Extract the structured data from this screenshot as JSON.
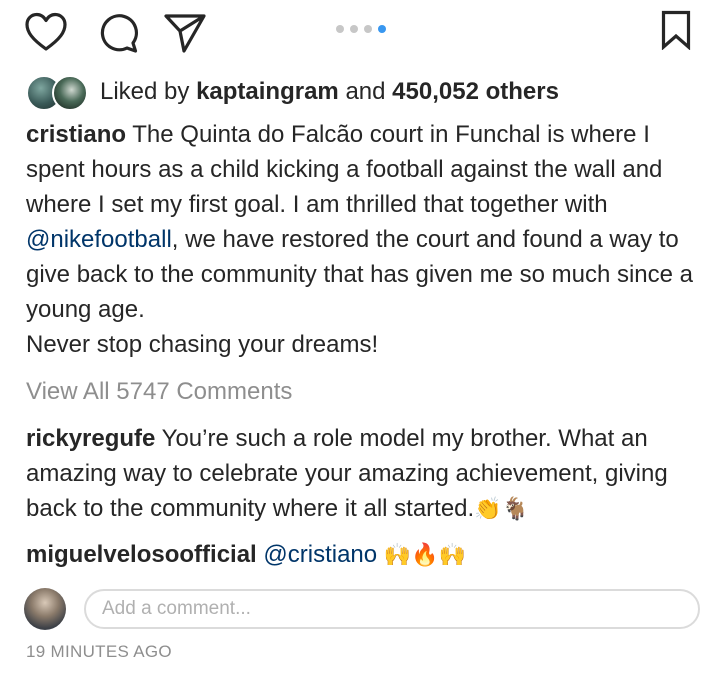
{
  "actions": {
    "like_icon": "heart-outline",
    "comment_icon": "speech-bubble",
    "share_icon": "paper-plane",
    "save_icon": "bookmark-outline",
    "carousel": {
      "count": 4,
      "active_index": 4
    }
  },
  "likes": {
    "prefix": "Liked by",
    "user": "kaptaingram",
    "conjunction": "and",
    "others": "450,052 others"
  },
  "caption": {
    "username": "cristiano",
    "text_before_mention": "The Quinta do Falcão court in Funchal is where I spent hours as a child kicking a football against the wall and where I set my first goal. I am thrilled that together with",
    "mention": "@nikefootball",
    "text_after_mention": ", we have restored the court and found a way to give back to the community that has given me so much since a young age.",
    "last_line": "Never stop chasing your dreams!"
  },
  "view_all": "View All 5747 Comments",
  "comments": [
    {
      "username": "rickyregufe",
      "text": "You’re such a role model my brother. What an amazing way to celebrate your amazing achievement, giving back to the community where it all started.",
      "emoji": "👏🐐"
    },
    {
      "username": "miguelvelosoofficial",
      "mention": "@cristiano",
      "emoji": "🙌🔥🙌"
    }
  ],
  "add_comment": {
    "placeholder": "Add a comment..."
  },
  "timestamp": "19 MINUTES AGO",
  "colors": {
    "accent": "#3897f0",
    "mention": "#003569",
    "muted": "#8e8e8e",
    "text": "#262626"
  }
}
